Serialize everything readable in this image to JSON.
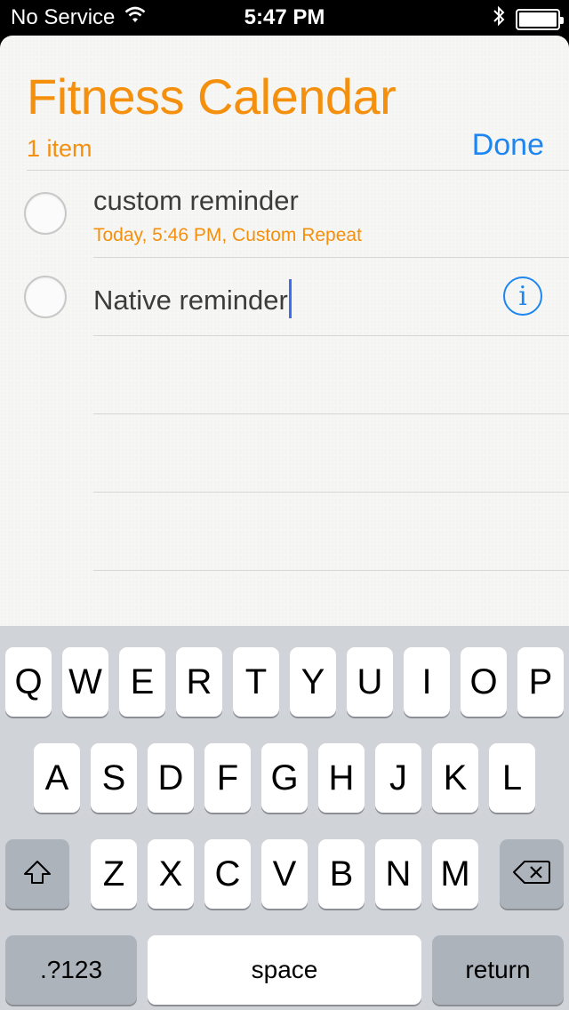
{
  "status_bar": {
    "carrier": "No Service",
    "time": "5:47 PM"
  },
  "list": {
    "title": "Fitness Calendar",
    "count": "1 item",
    "done_label": "Done",
    "title_color": "#f4900e",
    "accent_color": "#1d86f0"
  },
  "reminders": [
    {
      "title": "custom reminder",
      "subtitle": "Today, 5:46 PM, Custom Repeat"
    },
    {
      "title": "Native reminder",
      "subtitle": ""
    }
  ],
  "keyboard": {
    "row1": [
      "Q",
      "W",
      "E",
      "R",
      "T",
      "Y",
      "U",
      "I",
      "O",
      "P"
    ],
    "row2": [
      "A",
      "S",
      "D",
      "F",
      "G",
      "H",
      "J",
      "K",
      "L"
    ],
    "row3": [
      "Z",
      "X",
      "C",
      "V",
      "B",
      "N",
      "M"
    ],
    "numbers_label": ".?123",
    "space_label": "space",
    "return_label": "return"
  }
}
